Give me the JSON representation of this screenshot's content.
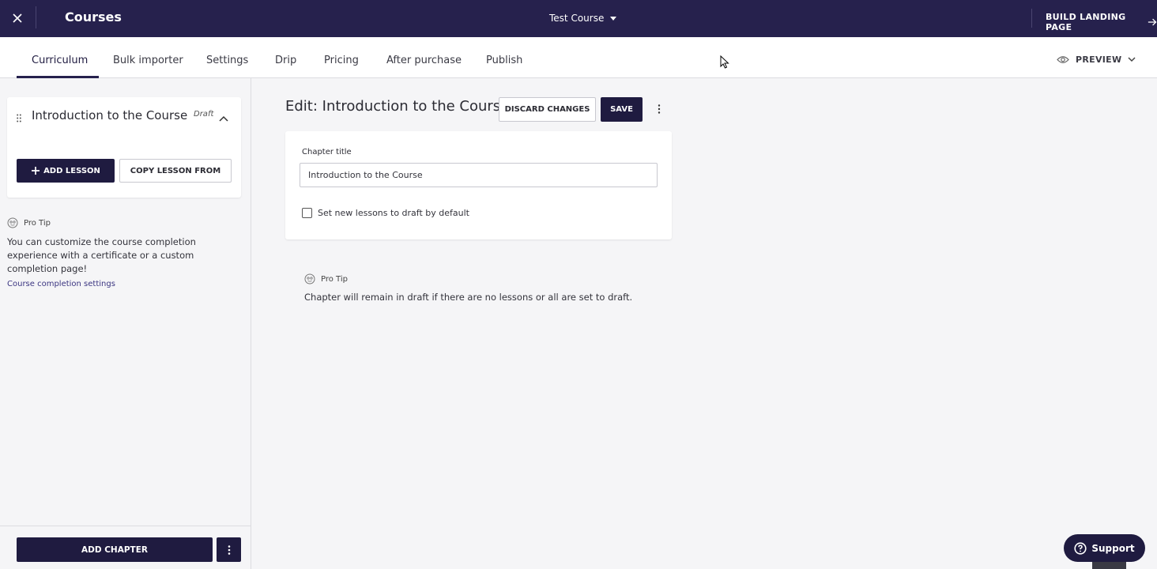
{
  "header": {
    "app_title": "Courses",
    "course_name": "Test Course",
    "build_landing": "BUILD LANDING PAGE"
  },
  "tabs": [
    {
      "label": "Curriculum",
      "active": true
    },
    {
      "label": "Bulk importer"
    },
    {
      "label": "Settings"
    },
    {
      "label": "Drip"
    },
    {
      "label": "Pricing"
    },
    {
      "label": "After purchase"
    },
    {
      "label": "Publish"
    }
  ],
  "preview_label": "PREVIEW",
  "sidebar": {
    "chapter_title": "Introduction to the Course",
    "chapter_status": "Draft",
    "add_lesson": "ADD LESSON",
    "copy_lesson": "COPY LESSON FROM",
    "protip_label": "Pro Tip",
    "protip_text": "You can customize the course completion experience with a certificate or a custom completion page!",
    "protip_link": "Course completion settings",
    "add_chapter": "ADD CHAPTER"
  },
  "main": {
    "edit_title": "Edit: Introduction to the Course",
    "discard": "DISCARD CHANGES",
    "save": "SAVE",
    "field_label": "Chapter title",
    "field_value": "Introduction to the Course",
    "checkbox_label": "Set new lessons to draft by default",
    "checkbox_checked": false,
    "protip_label": "Pro Tip",
    "protip_text": "Chapter will remain in draft if there are no lessons or all are set to draft."
  },
  "support_label": "Support",
  "colors": {
    "brand": "#26214d",
    "button_dark": "#1f1b40",
    "background": "#f5f5f7"
  }
}
